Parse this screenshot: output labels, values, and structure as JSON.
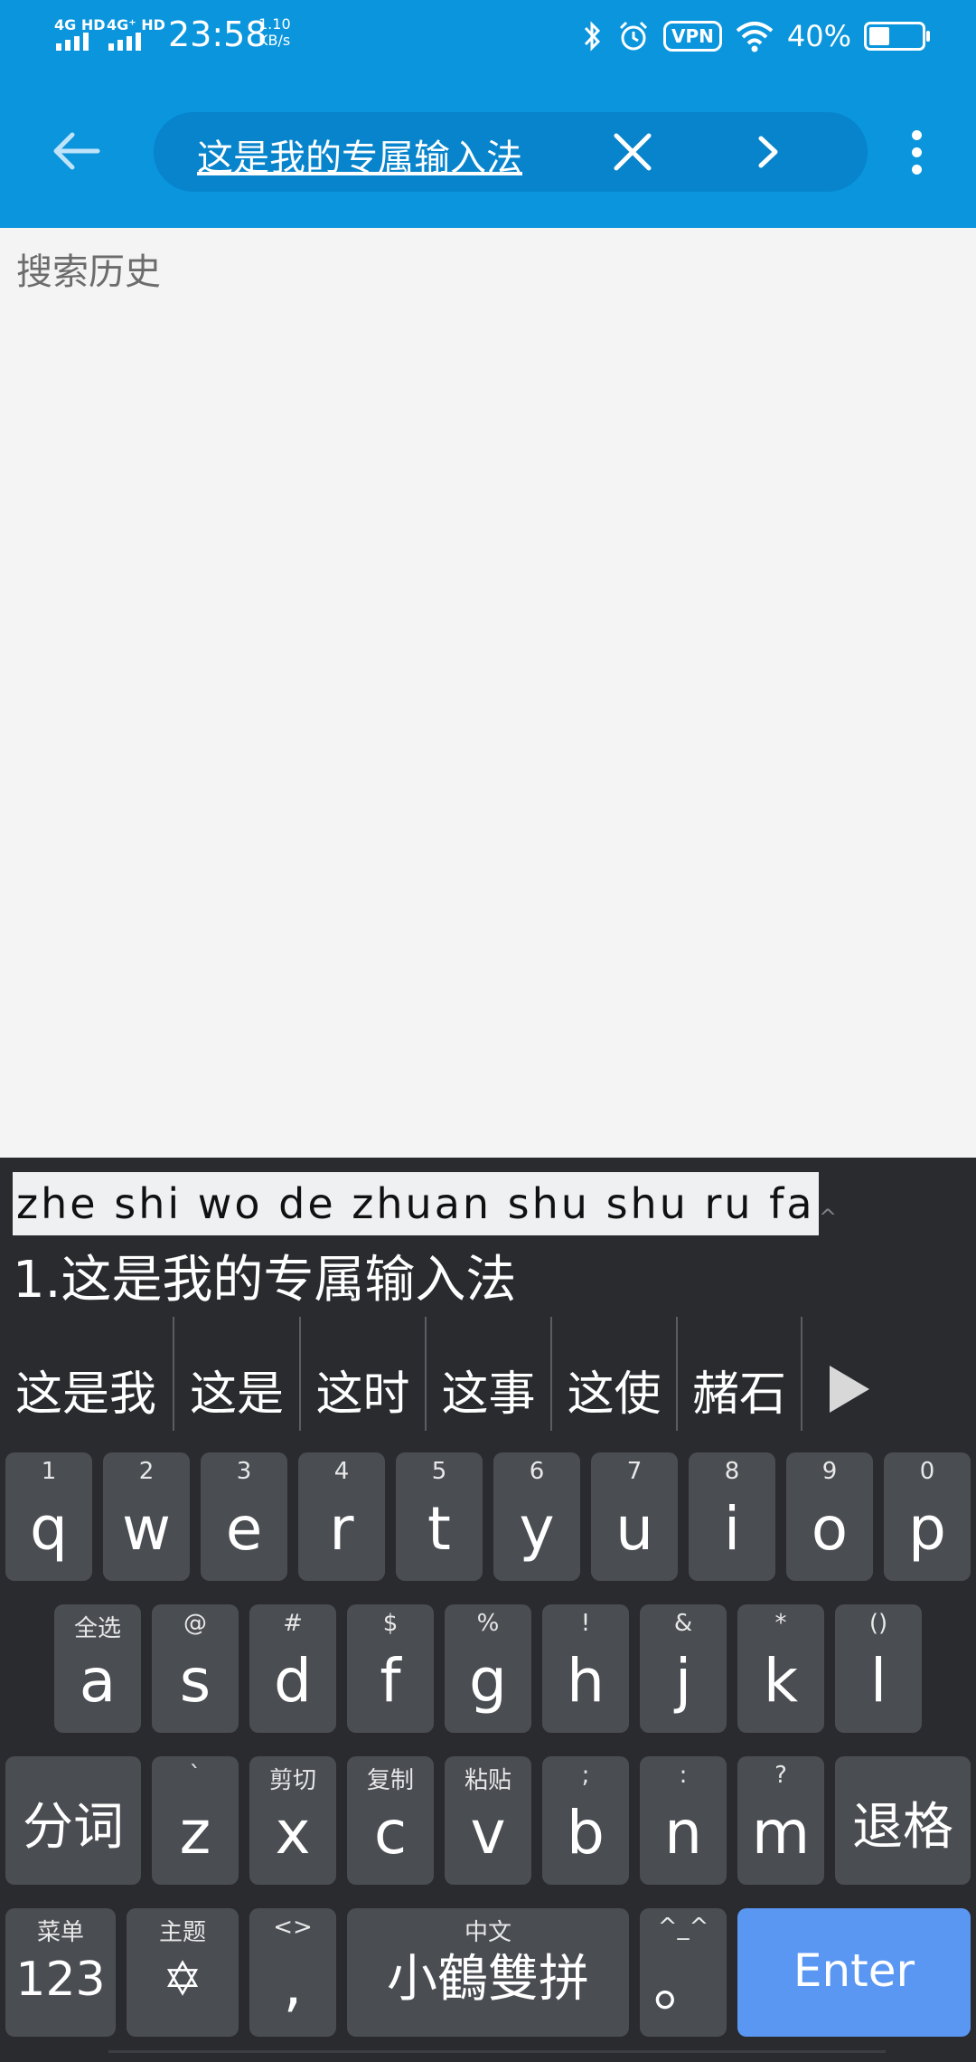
{
  "status_bar": {
    "signal1": "4G HD",
    "signal2": "4G⁺ HD",
    "time": "23:58",
    "speed_value": "1.10",
    "speed_unit": "KB/s",
    "vpn": "VPN",
    "battery_pct": "40%",
    "battery_level": 0.4
  },
  "toolbar": {
    "search_text": "这是我的专属输入法"
  },
  "main": {
    "history_title": "搜索历史"
  },
  "ime": {
    "pinyin": "zhe shi wo de zhuan shu shu ru fa",
    "caret": "^",
    "composed": "1.这是我的专属输入法",
    "candidates": [
      "这是我",
      "这是",
      "这时",
      "这事",
      "这使",
      "赭石"
    ],
    "row1": [
      {
        "main": "q",
        "sec": "1"
      },
      {
        "main": "w",
        "sec": "2"
      },
      {
        "main": "e",
        "sec": "3"
      },
      {
        "main": "r",
        "sec": "4"
      },
      {
        "main": "t",
        "sec": "5"
      },
      {
        "main": "y",
        "sec": "6"
      },
      {
        "main": "u",
        "sec": "7"
      },
      {
        "main": "i",
        "sec": "8"
      },
      {
        "main": "o",
        "sec": "9"
      },
      {
        "main": "p",
        "sec": "0"
      }
    ],
    "row2": [
      {
        "main": "a",
        "sec": "全选"
      },
      {
        "main": "s",
        "sec": "@"
      },
      {
        "main": "d",
        "sec": "#"
      },
      {
        "main": "f",
        "sec": "$"
      },
      {
        "main": "g",
        "sec": "%"
      },
      {
        "main": "h",
        "sec": "!"
      },
      {
        "main": "j",
        "sec": "&"
      },
      {
        "main": "k",
        "sec": "*"
      },
      {
        "main": "l",
        "sec": "()"
      }
    ],
    "row3": [
      {
        "main": "分词",
        "sec": ""
      },
      {
        "main": "z",
        "sec": "`"
      },
      {
        "main": "x",
        "sec": "剪切"
      },
      {
        "main": "c",
        "sec": "复制"
      },
      {
        "main": "v",
        "sec": "粘贴"
      },
      {
        "main": "b",
        "sec": ";"
      },
      {
        "main": "n",
        "sec": ":"
      },
      {
        "main": "m",
        "sec": "?"
      },
      {
        "main": "退格",
        "sec": ""
      }
    ],
    "row4": [
      {
        "main": "123",
        "sec": "菜单"
      },
      {
        "main": "✡",
        "sec": "主题"
      },
      {
        "main": ",",
        "sec": "<>"
      },
      {
        "main": "小鶴雙拼",
        "sec": "中文"
      },
      {
        "main": "。",
        "sec": "^_^"
      },
      {
        "main": "Enter",
        "sec": ""
      }
    ]
  }
}
